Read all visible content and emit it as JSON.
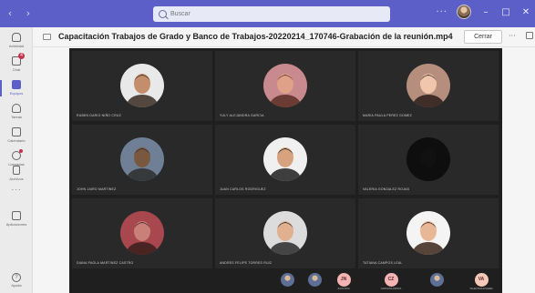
{
  "search": {
    "placeholder": "Buscar"
  },
  "rail": {
    "items": [
      {
        "label": "Actividad",
        "icon": "bell-icon"
      },
      {
        "label": "Chat",
        "icon": "chat-icon",
        "badge": "4"
      },
      {
        "label": "Equipos",
        "icon": "teams-icon"
      },
      {
        "label": "Tareas",
        "icon": "assignments-icon"
      },
      {
        "label": "Calendario",
        "icon": "calendar-icon"
      },
      {
        "label": "Llamadas",
        "icon": "phone-icon"
      },
      {
        "label": "Archivos",
        "icon": "files-icon"
      },
      {
        "label": "Aplicaciones",
        "icon": "apps-icon"
      }
    ],
    "more": "···",
    "help_label": "Ayuda"
  },
  "header": {
    "title": "Capacitación Trabajos de Grado y Banco de Trabajos-20220214_170746-Grabación de la reunión.mp4",
    "close_label": "Cerrar",
    "more": "···"
  },
  "titlebar": {
    "more": "···",
    "back": "‹",
    "forward": "›",
    "minimize": "–",
    "maximize": "□",
    "close": "✕"
  },
  "participants": [
    {
      "name": "RUBEN DARIO NIÑO CRUZ",
      "skin": "#c48d6c",
      "bg": "#e9e9e9",
      "hair": "#3a2a22"
    },
    {
      "name": "YULY ALEJANDRA GARCIA",
      "skin": "#e0a189",
      "bg": "#c88a8e",
      "hair": "#5a2e24"
    },
    {
      "name": "MARIA PAULA PEREZ GOMEZ",
      "skin": "#f0c7ad",
      "bg": "#b58e7e",
      "hair": "#2a1d18"
    },
    {
      "name": "JOHN JAIRO MARTINEZ",
      "skin": "#7a5840",
      "bg": "#6f7f95",
      "hair": "#2e2e2e"
    },
    {
      "name": "JUAN CARLOS RODRIGUEZ",
      "skin": "#d7a37f",
      "bg": "#f0f0f0",
      "hair": "#1e1e1e"
    },
    {
      "name": "VALERIA GONZALEZ ROJAS",
      "skin": "#111111",
      "bg": "#0e0e0e",
      "hair": "#0e0e0e"
    },
    {
      "name": "DIANA PAOLA MARTINEZ CASTRO",
      "skin": "#c98078",
      "bg": "#a9474f",
      "hair": "#3a1f1a"
    },
    {
      "name": "ANDRES FELIPE TORRES RUIZ",
      "skin": "#e0b090",
      "bg": "#dcdcdc",
      "hair": "#2a2a2a"
    },
    {
      "name": "TATIANA CAMPOS LEAL",
      "skin": "#e8b896",
      "bg": "#f4f4f4",
      "hair": "#3a2318"
    }
  ],
  "strip": [
    {
      "initials": "",
      "name": "",
      "type": "photo",
      "color": ""
    },
    {
      "initials": "",
      "name": "",
      "type": "photo",
      "color": ""
    },
    {
      "initials": "JN",
      "name": "JUAN NIÑO",
      "type": "initials",
      "color": "#f4b4b4"
    },
    {
      "initials": "CZ",
      "name": "CAROLINA ZAPATA",
      "type": "initials",
      "color": "#f4b4b4"
    },
    {
      "initials": "",
      "name": "",
      "type": "photo",
      "color": ""
    },
    {
      "initials": "VA",
      "name": "VALENTINA ALVAREZ",
      "type": "initials",
      "color": "#f6c8b8"
    }
  ],
  "colors": {
    "accent": "#5b5fc7",
    "video_bg": "#1f1f1f",
    "tile_bg": "#292929"
  }
}
